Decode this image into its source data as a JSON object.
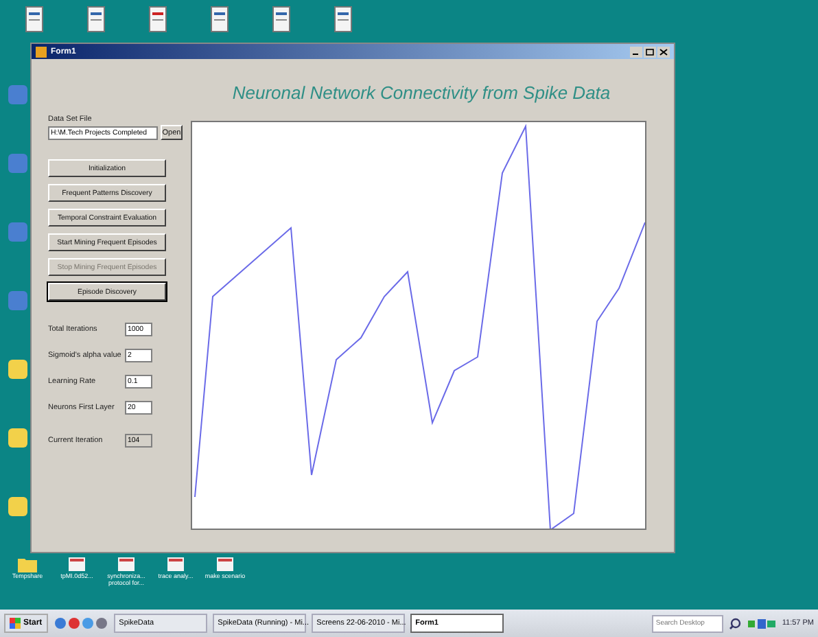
{
  "desktop": {
    "icons": [
      {
        "label": "Tempshare"
      },
      {
        "label": "tpMI.0d52..."
      },
      {
        "label": "synchroniza... protocol for..."
      },
      {
        "label": "trace analy..."
      },
      {
        "label": "make scenario"
      }
    ]
  },
  "window": {
    "title": "Form1",
    "heading": "Neuronal Network Connectivity from Spike Data",
    "data_file": {
      "label": "Data Set File",
      "value": "H:\\M.Tech Projects Completed",
      "button": "Open"
    },
    "buttons": [
      {
        "label": "Initialization",
        "disabled": false,
        "focused": false
      },
      {
        "label": "Frequent Patterns Discovery",
        "disabled": false,
        "focused": false
      },
      {
        "label": "Temporal Constraint Evaluation",
        "disabled": false,
        "focused": false
      },
      {
        "label": "Start Mining Frequent Episodes",
        "disabled": false,
        "focused": false
      },
      {
        "label": "Stop Mining Frequent Episodes",
        "disabled": true,
        "focused": false
      },
      {
        "label": "Episode Discovery",
        "disabled": false,
        "focused": true
      }
    ],
    "fields": [
      {
        "label": "Total Iterations",
        "value": "1000",
        "readonly": false
      },
      {
        "label": "Sigmoid's alpha value",
        "value": "2",
        "readonly": false
      },
      {
        "label": "Learning Rate",
        "value": "0.1",
        "readonly": false
      },
      {
        "label": "Neurons First Layer",
        "value": "20",
        "readonly": false
      },
      {
        "label": "Current Iteration",
        "value": "104",
        "readonly": true
      }
    ]
  },
  "taskbar": {
    "start": "Start",
    "tasks": [
      {
        "label": "SpikeData",
        "selected": false
      },
      {
        "label": "SpikeData (Running) - Mi...",
        "selected": false
      },
      {
        "label": "Screens 22-06-2010 - Mi...",
        "selected": false
      },
      {
        "label": "Form1",
        "selected": true
      }
    ],
    "search": {
      "placeholder": "Search Desktop"
    },
    "clock": "11:57 PM"
  }
}
